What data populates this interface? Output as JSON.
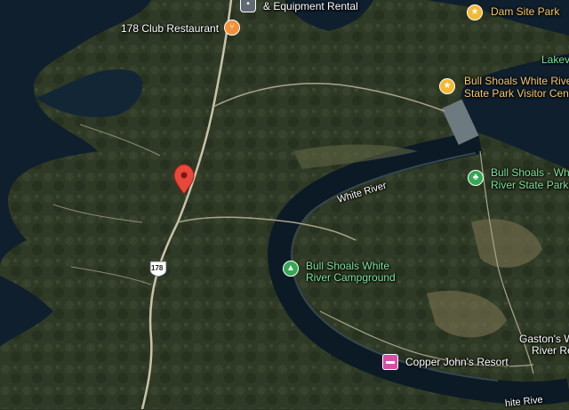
{
  "map": {
    "colors": {
      "water": "#0f1f2e",
      "land": "#2f3a26",
      "road": "#c9c2a8",
      "pin": "#e8473b",
      "park_marker": "#34a853",
      "star_marker": "#f2b933",
      "food_marker": "#f0913a",
      "hotel_marker": "#d64fa6"
    },
    "pin": {
      "icon": "location-pin-icon"
    },
    "route_shield": {
      "text": "178"
    },
    "river_label": {
      "text": "White River"
    },
    "river_label_bottom": {
      "text": "hite Rive"
    },
    "town_label": {
      "text": "Lakev"
    },
    "places": {
      "equipment_rental": {
        "text": "& Equipment Rental",
        "icon": "shop-icon"
      },
      "club_restaurant": {
        "text": "178 Club Restaurant",
        "icon": "restaurant-icon"
      },
      "dam_site_park": {
        "text": "Dam Site Park",
        "icon": "star-icon"
      },
      "visitor_center": {
        "line1": "Bull Shoals White Rive",
        "line2": "State Park Visitor Cent",
        "icon": "star-icon"
      },
      "white_river_state_park": {
        "line1": "Bull Shoals - Whi",
        "line2": "River State Park",
        "icon": "tree-icon"
      },
      "campground": {
        "line1": "Bull Shoals White",
        "line2": "River Campground",
        "icon": "tent-icon"
      },
      "copper_johns": {
        "text": "Copper John's Resort",
        "icon": "bed-icon"
      },
      "gastons": {
        "line1": "Gaston's W",
        "line2": "River Res"
      }
    }
  }
}
